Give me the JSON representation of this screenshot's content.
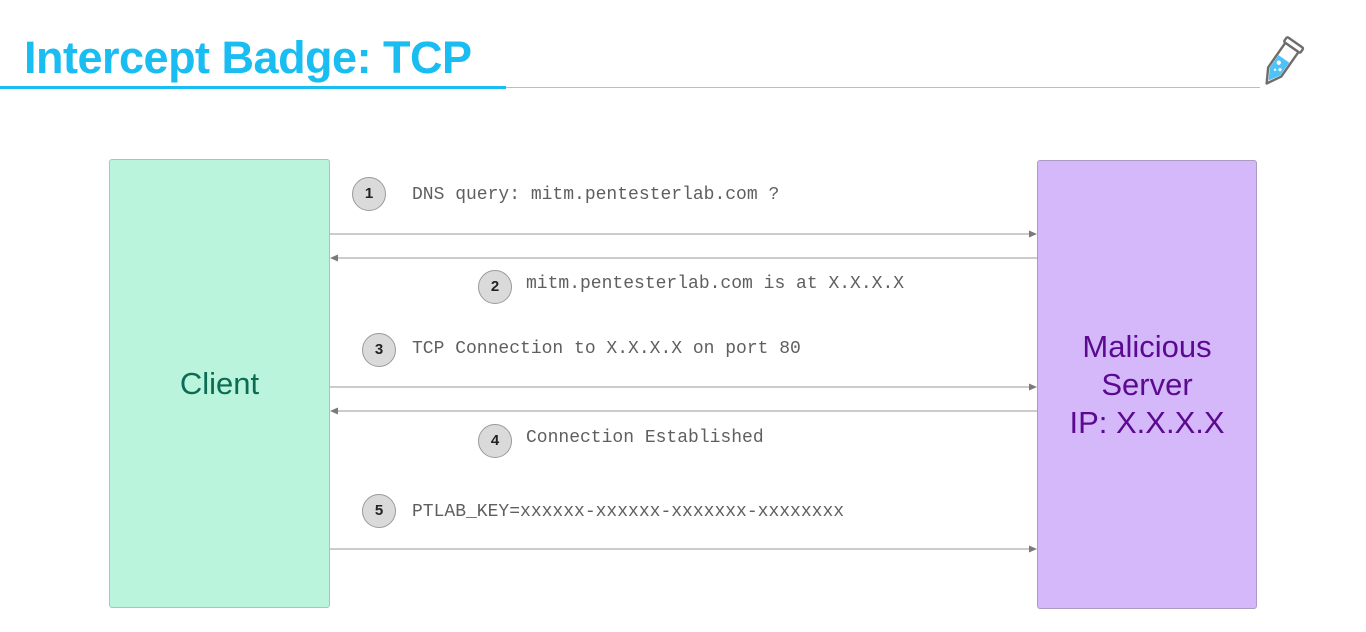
{
  "header": {
    "title": "Intercept Badge: TCP",
    "logo_icon": "flask-pen-icon"
  },
  "diagram": {
    "client": {
      "label": "Client"
    },
    "server": {
      "lines": [
        "Malicious",
        "Server",
        "IP: X.X.X.X"
      ]
    },
    "steps": [
      {
        "number": "1",
        "text": "DNS query: mitm.pentesterlab.com ?",
        "direction": "client-to-server"
      },
      {
        "number": "2",
        "text": "mitm.pentesterlab.com is at X.X.X.X",
        "direction": "server-to-client"
      },
      {
        "number": "3",
        "text": "TCP Connection to X.X.X.X on port 80",
        "direction": "client-to-server"
      },
      {
        "number": "4",
        "text": "Connection Established",
        "direction": "server-to-client"
      },
      {
        "number": "5",
        "text": "PTLAB_KEY=xxxxxx-xxxxxx-xxxxxxx-xxxxxxxx",
        "direction": "client-to-server"
      }
    ]
  },
  "colors": {
    "accent": "#19bdf2",
    "client_fill": "#baf4dd",
    "client_text": "#0b6b53",
    "server_fill": "#d4b8fa",
    "server_text": "#5b0a8f",
    "arrow": "#9a9a9a"
  }
}
